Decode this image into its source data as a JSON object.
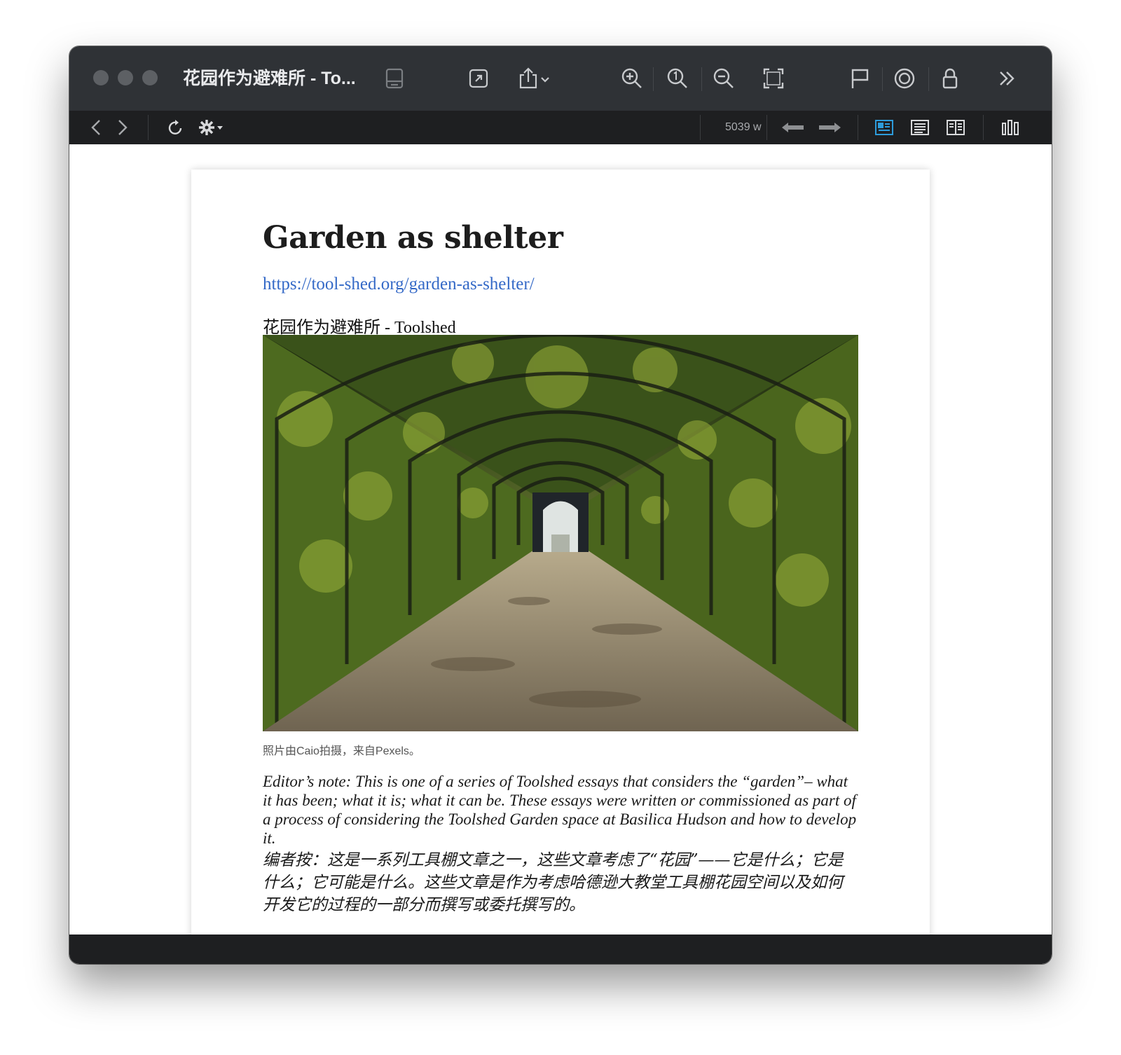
{
  "window": {
    "title": "花园作为避难所 - To...",
    "word_count": "5039 w"
  },
  "icons": {
    "titlebar": [
      "sidebar-toggle-icon",
      "open-external-icon",
      "share-icon",
      "zoom-in-icon",
      "actual-size-icon",
      "zoom-out-icon",
      "fit-window-icon",
      "flag-icon",
      "target-icon",
      "lock-icon",
      "more-chevrons-icon"
    ],
    "toolbar": [
      "back-icon",
      "forward-icon",
      "reload-icon",
      "gear-icon",
      "arrow-left-icon",
      "arrow-right-icon",
      "layout-card-icon",
      "layout-text-icon",
      "layout-split-icon",
      "format-icon"
    ]
  },
  "article": {
    "title": "Garden as shelter",
    "url": "https://tool-shed.org/garden-as-shelter/",
    "subtitle": "花园作为避难所 - Toolshed",
    "photo_caption": "照片由Caio拍摄，来自Pexels。",
    "editor_note": "Editor’s note: This is one of a series of Toolshed essays that considers the “garden”– what it has been; what it is; what it can be. These essays were written or commissioned as part of a process of considering the Toolshed Garden space at Basilica Hudson and how to develop it.",
    "editor_note_cn": "编者按：这是一系列工具棚文章之一，这些文章考虑了“花园”——它是什么；它是什么；它可能是什么。这些文章是作为考虑哈德逊大教堂工具棚花园空间以及如何开发它的过程的一部分而撰写或委托撰写的。"
  },
  "colors": {
    "titlebar": "#2f3236",
    "toolbar": "#1e1f21",
    "link": "#3469c7",
    "active_view": "#2d9cdb"
  }
}
